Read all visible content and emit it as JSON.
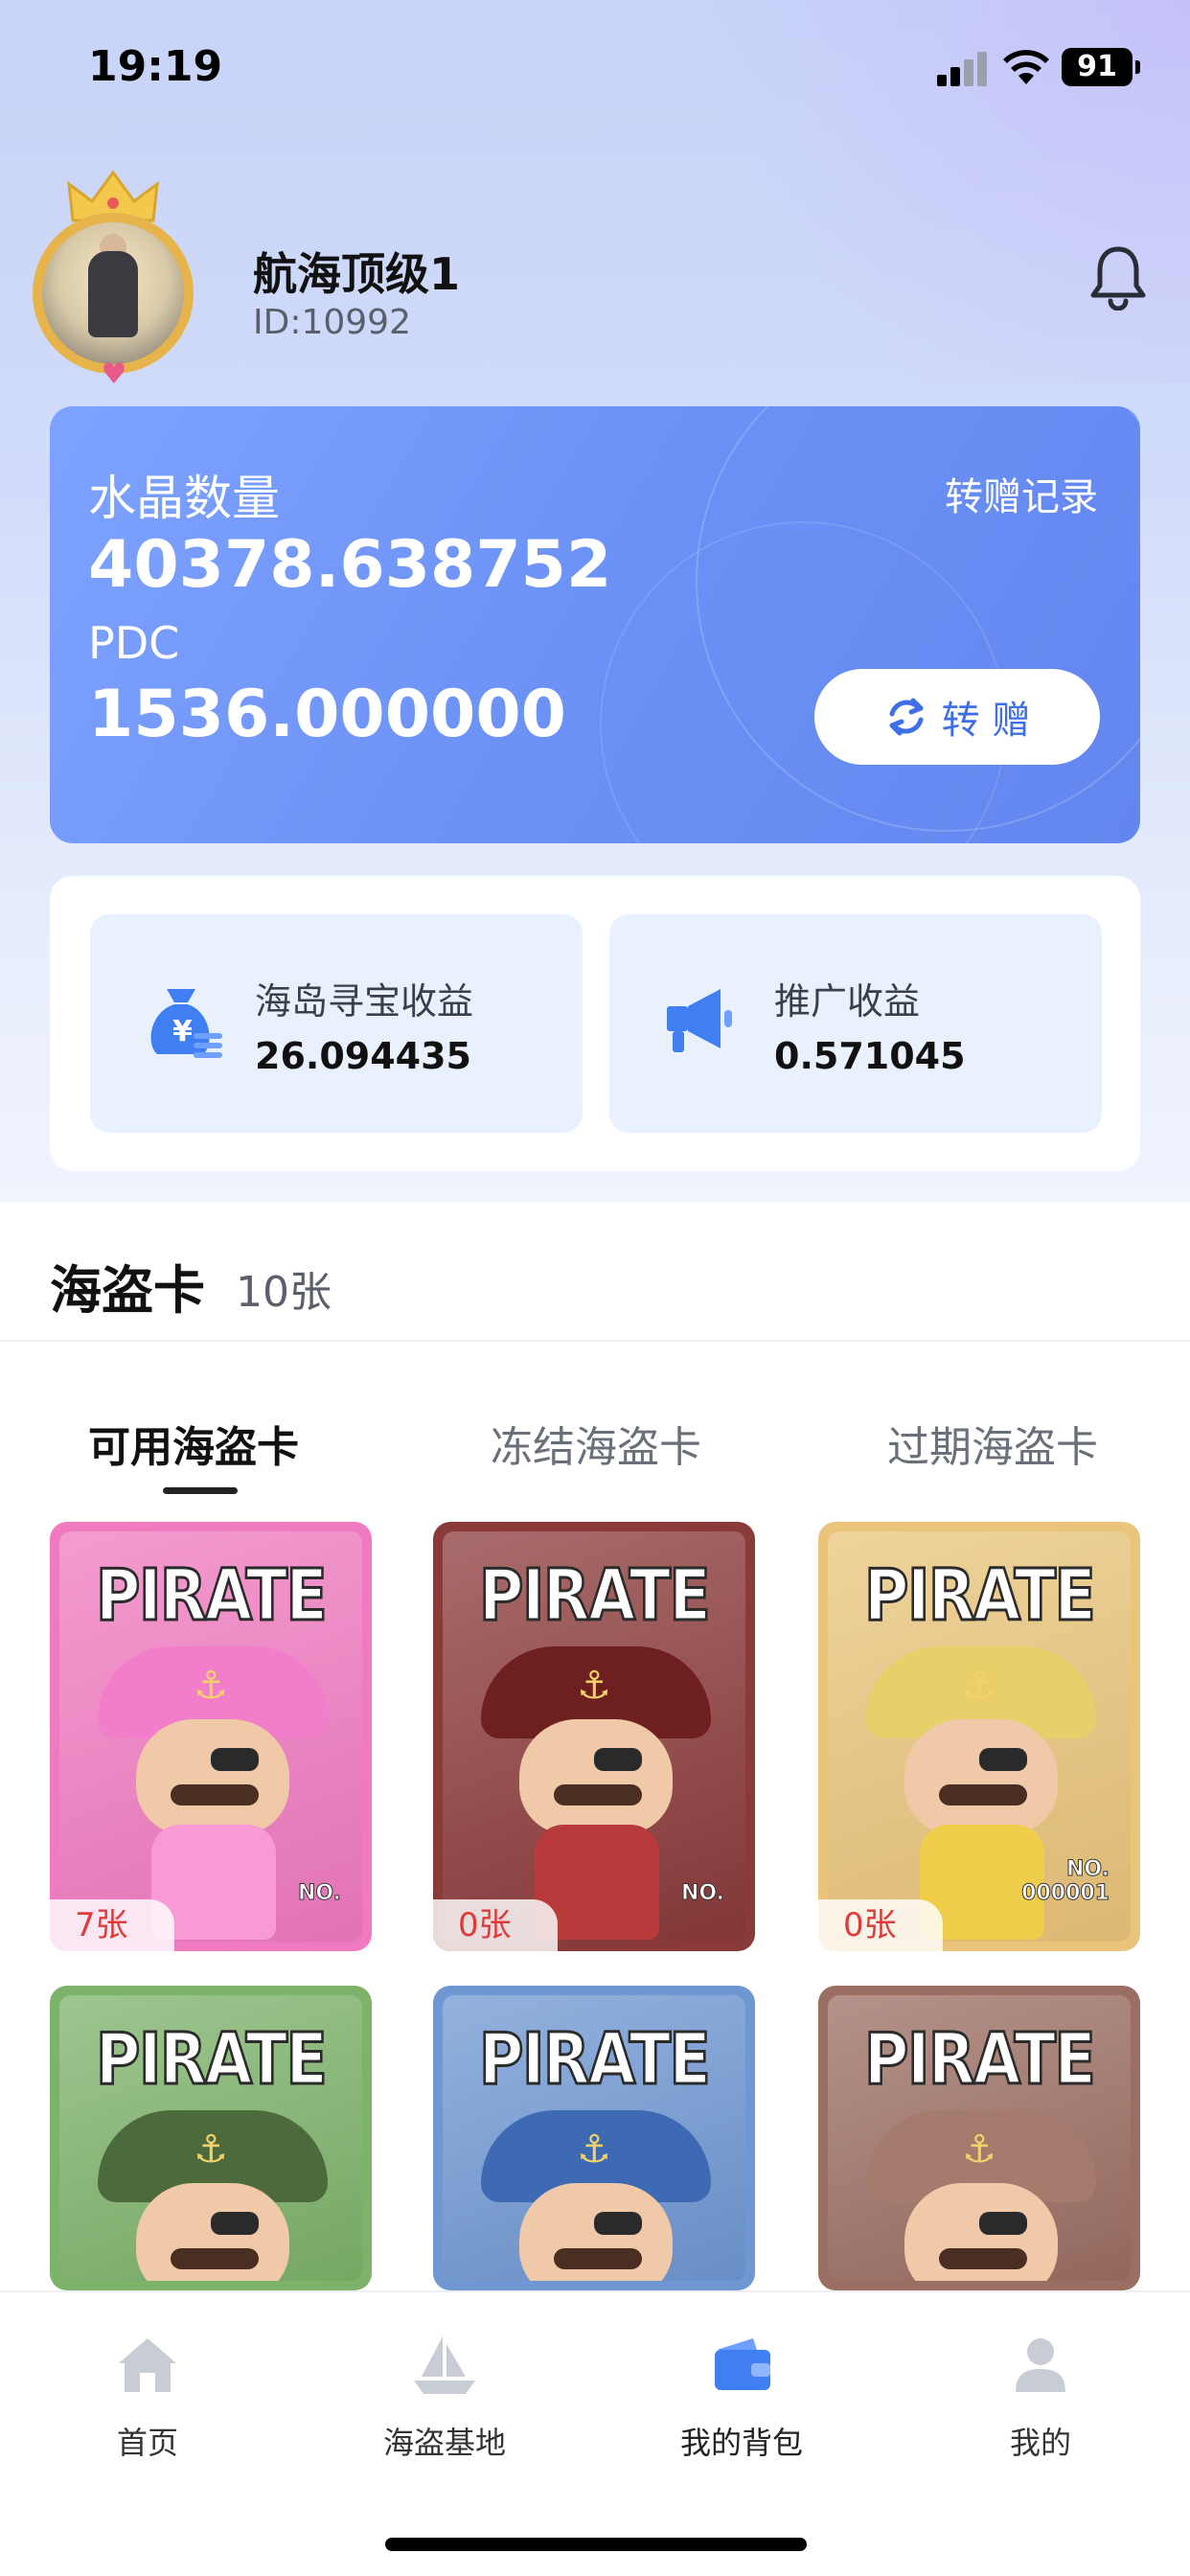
{
  "status_bar": {
    "time": "19:19",
    "battery": "91"
  },
  "profile": {
    "name": "航海顶级1",
    "id": "ID:10992"
  },
  "wallet": {
    "label": "水晶数量",
    "record_link": "转赠记录",
    "crystal_value": "40378.638752",
    "pdc_label": "PDC",
    "pdc_value": "1536.000000",
    "transfer_button": "转 赠"
  },
  "income": [
    {
      "label": "海岛寻宝收益",
      "value": "26.094435",
      "icon": "money-bag-icon"
    },
    {
      "label": "推广收益",
      "value": "0.571045",
      "icon": "megaphone-icon"
    }
  ],
  "pirate_section": {
    "title": "海盗卡",
    "count": "10张",
    "tabs": [
      {
        "label": "可用海盗卡",
        "active": true
      },
      {
        "label": "冻结海盗卡",
        "active": false
      },
      {
        "label": "过期海盗卡",
        "active": false
      }
    ],
    "cards": [
      {
        "title": "PIRATE",
        "count": "7张",
        "no": "NO.",
        "theme": "#f07ac0",
        "hat": "#f27ecb",
        "body": "#f79ad6"
      },
      {
        "title": "PIRATE",
        "count": "0张",
        "no": "NO.",
        "theme": "#8b3a3a",
        "hat": "#6e1f1f",
        "body": "#b93a3a"
      },
      {
        "title": "PIRATE",
        "count": "0张",
        "no": "NO.\n000001",
        "theme": "#e9c47a",
        "hat": "#e8cf6a",
        "body": "#f0cd4a"
      },
      {
        "title": "PIRATE",
        "count": "",
        "no": "",
        "theme": "#7db26a",
        "hat": "#4d6a3d",
        "body": "#6a8a55"
      },
      {
        "title": "PIRATE",
        "count": "",
        "no": "",
        "theme": "#6f97d2",
        "hat": "#3e6ab3",
        "body": "#4a7ec4"
      },
      {
        "title": "PIRATE",
        "count": "",
        "no": "",
        "theme": "#9b6e62",
        "hat": "#a47b6c",
        "body": "#8a5d52"
      }
    ]
  },
  "nav": [
    {
      "label": "首页",
      "icon": "home-icon",
      "active": false
    },
    {
      "label": "海盗基地",
      "icon": "ship-icon",
      "active": false
    },
    {
      "label": "我的背包",
      "icon": "wallet-icon",
      "active": true
    },
    {
      "label": "我的",
      "icon": "user-icon",
      "active": false
    }
  ],
  "colors": {
    "accent": "#3f6fe8",
    "wallet_gradient_start": "#7ea2ff",
    "wallet_gradient_end": "#6386ee",
    "count_red": "#e03a3a",
    "nav_active": "#3f7ff2",
    "nav_inactive": "#c8ccd4"
  }
}
